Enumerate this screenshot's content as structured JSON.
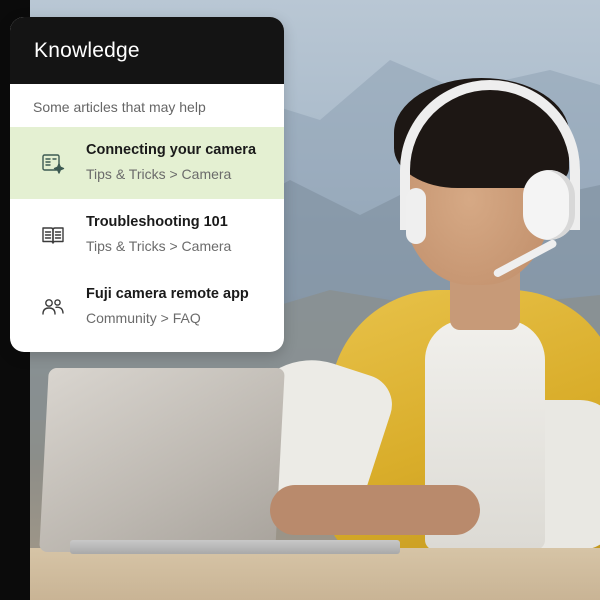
{
  "knowledge": {
    "title": "Knowledge",
    "subtitle": "Some articles that may help",
    "articles": [
      {
        "title": "Connecting your camera",
        "path": "Tips & Tricks > Camera",
        "icon": "article-sparkle-icon",
        "highlighted": true
      },
      {
        "title": "Troubleshooting 101",
        "path": "Tips & Tricks > Camera",
        "icon": "book-icon",
        "highlighted": false
      },
      {
        "title": "Fuji camera remote app",
        "path": "Community > FAQ",
        "icon": "people-icon",
        "highlighted": false
      }
    ]
  },
  "colors": {
    "header_bg": "#141414",
    "highlight_bg": "#e4f0d2",
    "vest_yellow": "#e1b83a"
  },
  "photo": {
    "subject": "support agent wearing white headset, yellow puffer vest, typing on laptop",
    "icon": "photo-backdrop"
  }
}
